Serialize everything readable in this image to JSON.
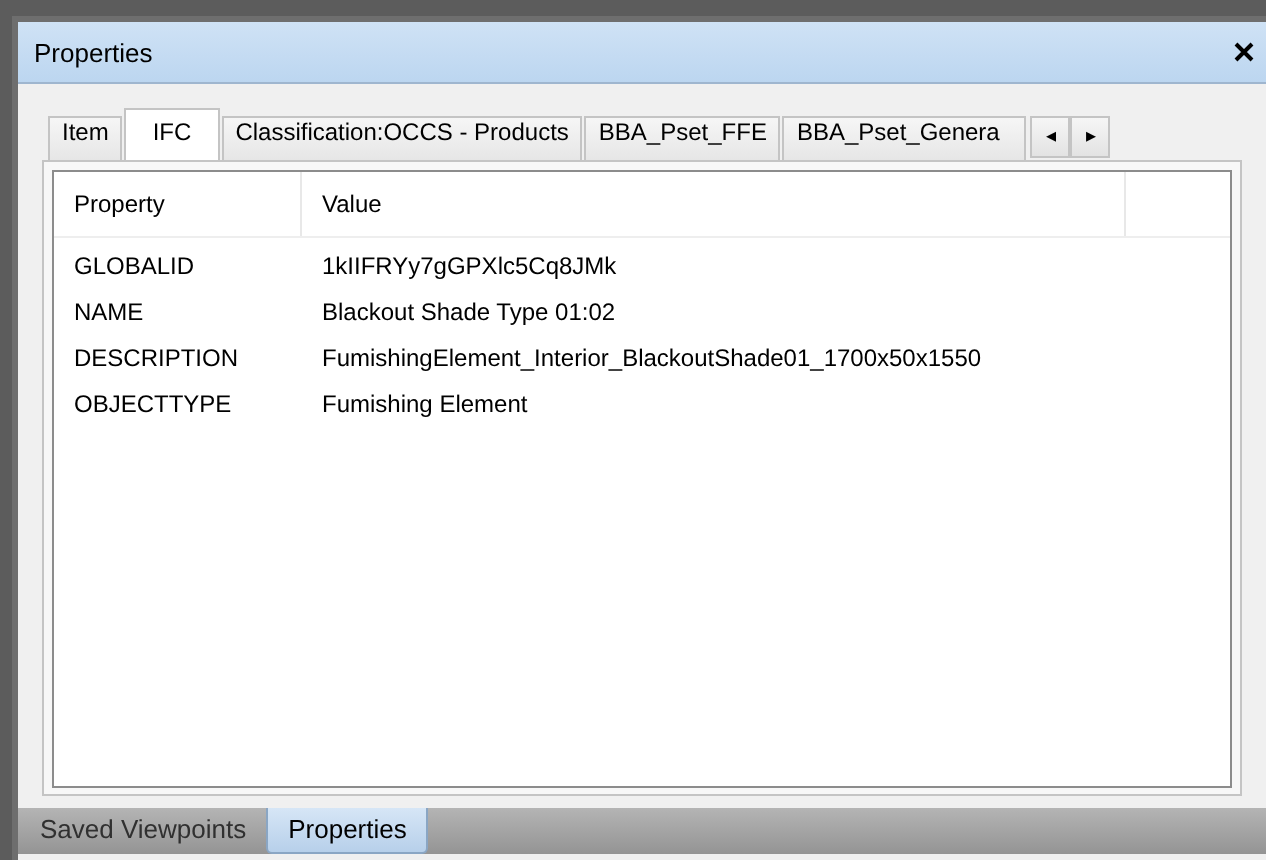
{
  "window": {
    "title": "Properties"
  },
  "tabs": [
    {
      "label": "Item",
      "selected": false
    },
    {
      "label": "IFC",
      "selected": true
    },
    {
      "label": "Classification:OCCS - Products",
      "selected": false
    },
    {
      "label": "BBA_Pset_FFE",
      "selected": false
    },
    {
      "label": "BBA_Pset_Genera",
      "selected": false
    }
  ],
  "tab_scroll": {
    "left": "◂",
    "right": "▸"
  },
  "table": {
    "columns": [
      "Property",
      "Value"
    ],
    "rows": [
      {
        "property": "GLOBALID",
        "value": "1kIIFRYy7gGPXlc5Cq8JMk"
      },
      {
        "property": "NAME",
        "value": "Blackout Shade Type 01:02"
      },
      {
        "property": "DESCRIPTION",
        "value": "FumishingElement_Interior_BlackoutShade01_1700x50x1550"
      },
      {
        "property": "OBJECTTYPE",
        "value": "Fumishing Element"
      }
    ]
  },
  "bottom_tabs": [
    {
      "label": "Saved Viewpoints",
      "selected": false
    },
    {
      "label": "Properties",
      "selected": true
    }
  ]
}
